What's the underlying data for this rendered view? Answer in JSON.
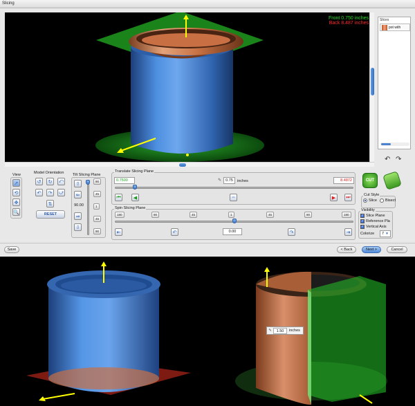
{
  "window": {
    "title": "Slicing"
  },
  "viewport": {
    "front_readout": "Front  0.750  inches",
    "back_readout": "Back  8.487  inches"
  },
  "slices_panel": {
    "title": "Slices",
    "item_label": "pot with"
  },
  "view_group": {
    "label": "View"
  },
  "model_orientation": {
    "label": "Model Orientation",
    "reset_label": "RESET"
  },
  "tilt": {
    "label": "Tilt Slicing Plane",
    "value": "90.00",
    "deg_labels": [
      "90",
      "45",
      "1",
      "45",
      "90"
    ]
  },
  "translate": {
    "label": "Translate Slicing Plane",
    "min_value": "0.7500",
    "current_value": "0.75",
    "unit": "inches",
    "max_value": "8.4872",
    "position_fraction": 0.0
  },
  "spin": {
    "label": "Spin Slicing Plane",
    "value": "0.00",
    "deg_labels": [
      "180",
      "90",
      "45",
      "1",
      "45",
      "90",
      "180"
    ],
    "position_fraction": 0.5
  },
  "cut": {
    "cut_label": "CUT"
  },
  "cut_style": {
    "label": "Cut Style",
    "options": [
      "Slice",
      "Bisect"
    ],
    "selected": "Slice"
  },
  "visibility": {
    "label": "Visibility",
    "slice_plane": "Slice Plane",
    "reference_plane": "Reference Pla",
    "vertical_axis": "Vertical Axis",
    "colorize_label": "Colorize",
    "colorize_value": "7"
  },
  "footer": {
    "save_label": "Save",
    "back_label": "< Back",
    "next_label": "Next >",
    "cancel_label": "Cancel"
  },
  "bottom_right": {
    "measure_value": "1.50",
    "measure_unit": "inches"
  },
  "colors": {
    "front": "#22e022",
    "back": "#ff2a2a",
    "pot_blue": "#3f7fce",
    "pot_copper": "#c86f44",
    "plane_green": "#27c42a"
  }
}
